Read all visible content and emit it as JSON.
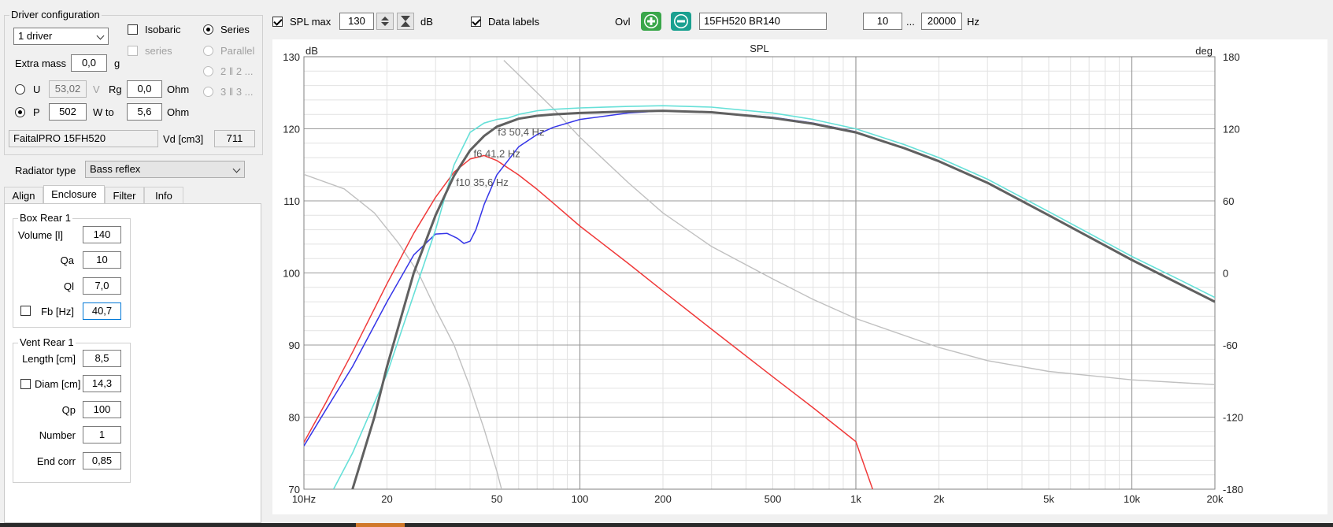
{
  "driver_config": {
    "title": "Driver configuration",
    "driver_count": "1 driver",
    "isobaric_label": "Isobaric",
    "series_label": "Series",
    "series_sub_label": "series",
    "parallel_label": "Parallel",
    "opt_2": "2 ‖ 2 ...",
    "opt_3": "3 ‖ 3 ...",
    "extra_mass_label": "Extra mass",
    "extra_mass_value": "0,0",
    "extra_mass_unit": "g",
    "u_label": "U",
    "u_value": "53,02",
    "u_unit": "V",
    "rg_label": "Rg",
    "rg_value": "0,0",
    "rg_unit": "Ohm",
    "p_label": "P",
    "p_value": "502",
    "w_to_label": "W to",
    "w_to_value": "5,6",
    "w_to_unit": "Ohm",
    "driver_name": "FaitalPRO 15FH520",
    "vd_label": "Vd [cm3]",
    "vd_value": "711"
  },
  "radiator": {
    "label": "Radiator type",
    "value": "Bass reflex"
  },
  "tabs": [
    "Align",
    "Enclosure",
    "Filter",
    "Info"
  ],
  "box_rear": {
    "title": "Box Rear 1",
    "fields": [
      {
        "label": "Volume [l]",
        "value": "140"
      },
      {
        "label": "Qa",
        "value": "10"
      },
      {
        "label": "Ql",
        "value": "7,0"
      },
      {
        "label": "Fb [Hz]",
        "value": "40,7"
      }
    ]
  },
  "vent_rear": {
    "title": "Vent Rear 1",
    "fields": [
      {
        "label": "Length [cm]",
        "value": "8,5"
      },
      {
        "label": "Diam [cm]",
        "value": "14,3"
      },
      {
        "label": "Qp",
        "value": "100"
      },
      {
        "label": "Number",
        "value": "1"
      },
      {
        "label": "End corr",
        "value": "0,85"
      }
    ]
  },
  "toolbar": {
    "spl_max_label": "SPL max",
    "spl_max_value": "130",
    "spl_unit": "dB",
    "data_labels_label": "Data labels",
    "ovl_label": "Ovl",
    "overlay_name": "15FH520 BR140",
    "freq_min": "10",
    "freq_dots": "...",
    "freq_max": "20000",
    "freq_unit": "Hz"
  },
  "colors": {
    "total": "#606060",
    "cyan": "#66e0d8",
    "blue": "#3535e8",
    "red": "#f03a3a",
    "phase": "#c0c0c0",
    "add_button": "#3aa64a",
    "remove_button": "#1aa090"
  },
  "chart_data": {
    "type": "line",
    "title": "SPL",
    "ylabel": "dB",
    "y2label": "deg",
    "xscale": "log",
    "xlim": [
      10,
      20000
    ],
    "ylim": [
      70,
      130
    ],
    "y2lim": [
      -180,
      180
    ],
    "x_ticks": [
      10,
      20,
      50,
      100,
      200,
      500,
      1000,
      2000,
      5000,
      10000,
      20000
    ],
    "x_tick_labels": [
      "10Hz",
      "20",
      "50",
      "100",
      "200",
      "500",
      "1k",
      "2k",
      "5k",
      "10k",
      "20k"
    ],
    "y_ticks": [
      70,
      80,
      90,
      100,
      110,
      120,
      130
    ],
    "y2_ticks": [
      -180,
      -120,
      -60,
      0,
      60,
      120,
      180
    ],
    "grid": true,
    "annotations": [
      {
        "text": "f3 50,4 Hz",
        "x": 50.4,
        "y": 119.5
      },
      {
        "text": "f6 41,2 Hz",
        "x": 41.2,
        "y": 116.5
      },
      {
        "text": "f10 35,6 Hz",
        "x": 35.6,
        "y": 112.5
      }
    ],
    "series": [
      {
        "color": "#606060",
        "axis": "left",
        "x": [
          15,
          18,
          20,
          25,
          30,
          35,
          40,
          45,
          50,
          60,
          70,
          80,
          100,
          150,
          200,
          300,
          500,
          700,
          1000,
          1500,
          2000,
          3000,
          5000,
          7000,
          10000,
          15000,
          20000
        ],
        "y": [
          70,
          80,
          87,
          100,
          108,
          113.5,
          117,
          119,
          120.3,
          121.4,
          121.8,
          122.0,
          122.2,
          122.4,
          122.5,
          122.3,
          121.5,
          120.7,
          119.5,
          117.3,
          115.5,
          112.5,
          108.0,
          105.0,
          101.8,
          98.4,
          96.0
        ]
      },
      {
        "color": "#66e0d8",
        "axis": "left",
        "x": [
          12.8,
          15,
          20,
          25,
          30,
          35,
          40,
          45,
          50,
          55,
          60,
          70,
          80,
          100,
          150,
          200,
          300,
          500,
          700,
          1000,
          1500,
          2000,
          3000,
          5000,
          7000,
          10000,
          15000,
          20000
        ],
        "y": [
          70,
          75,
          86,
          97,
          106,
          115,
          119.5,
          120.8,
          121.3,
          121.5,
          122.0,
          122.5,
          122.7,
          122.9,
          123.1,
          123.2,
          123.0,
          122.2,
          121.3,
          120.0,
          117.8,
          116.0,
          113.0,
          108.5,
          105.5,
          102.3,
          99.0,
          96.6
        ]
      },
      {
        "color": "#3535e8",
        "axis": "left",
        "x": [
          10,
          12,
          15,
          20,
          25,
          30,
          33,
          36,
          38,
          40,
          42,
          45,
          50,
          60,
          70,
          80,
          100,
          150,
          200,
          300,
          500,
          700,
          1000
        ],
        "y": [
          76,
          81,
          87,
          96,
          102.5,
          105.4,
          105.5,
          104.8,
          104.1,
          104.4,
          106.0,
          109.5,
          113.6,
          117.5,
          119.2,
          120.2,
          121.3,
          122.2,
          122.5,
          122.3,
          121.6,
          120.8,
          119.6
        ]
      },
      {
        "color": "#f03a3a",
        "axis": "left",
        "x": [
          10,
          12,
          15,
          20,
          25,
          30,
          35,
          40,
          45,
          50,
          60,
          70,
          80,
          100,
          150,
          200,
          300,
          500,
          700,
          1000,
          1150
        ],
        "y": [
          76.5,
          82,
          89,
          98.5,
          105.5,
          110.5,
          114,
          115.8,
          116.3,
          115.6,
          113.6,
          111.6,
          109.7,
          106.5,
          101.3,
          97.5,
          92.2,
          85.6,
          81.3,
          76.6,
          70
        ]
      },
      {
        "color": "#c0c0c0",
        "axis": "right",
        "x": [
          10,
          14,
          18,
          22,
          26,
          30,
          35,
          40,
          45,
          50,
          52
        ],
        "y": [
          82,
          70,
          50,
          25,
          0,
          -30,
          -60,
          -95,
          -130,
          -165,
          -180
        ]
      },
      {
        "color": "#c0c0c0",
        "axis": "right",
        "x": [
          53,
          60,
          70,
          80,
          100,
          150,
          200,
          300,
          500,
          700,
          1000,
          2000,
          3000,
          5000,
          10000,
          20000
        ],
        "y": [
          177,
          165,
          150,
          137,
          113,
          75,
          50,
          22,
          -5,
          -22,
          -38,
          -62,
          -73,
          -82,
          -89,
          -93
        ]
      }
    ]
  }
}
